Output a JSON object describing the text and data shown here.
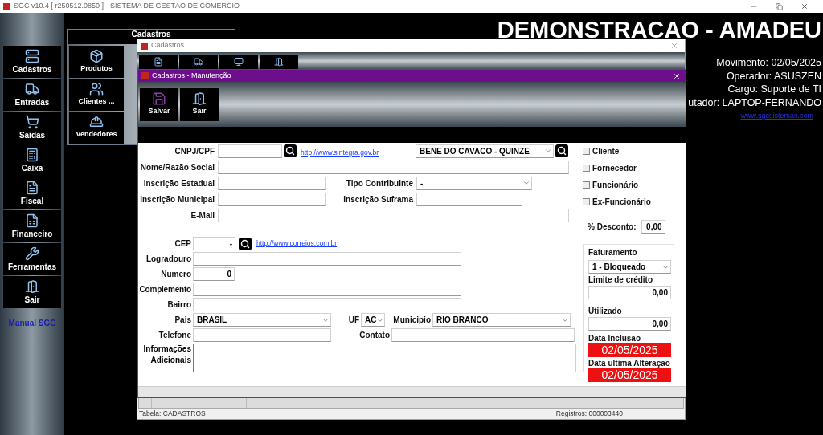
{
  "app": {
    "title": "SGC v10.4 [ r250512.0850 ] - SISTEMA DE GESTÃO DE COMÉRCIO"
  },
  "sidebar": {
    "items": [
      "Cadastros",
      "Entradas",
      "Saidas",
      "Caixa",
      "Fiscal",
      "Financeiro",
      "Ferramentas",
      "Sair"
    ],
    "manual_link": "Manual SGC"
  },
  "submenu": {
    "title": "Cadastros",
    "items": [
      "Produtos",
      "Clientes ...",
      "Vendedores"
    ]
  },
  "header": {
    "company": "DEMONSTRACAO - AMADEU",
    "info": [
      "Movimento: 02/05/2025",
      "Operador: ASUSZEN",
      "Cargo: Suporte de TI",
      "utador: LAPTOP-FERNANDO"
    ],
    "link": "www.sgcsistemas.com"
  },
  "cadastros_window": {
    "title": "Cadastros",
    "status_bar": {
      "table": "Tabela: CADASTROS",
      "records": "Registros: 000003440"
    }
  },
  "maintenance_window": {
    "title": "Cadastros - Manutenção",
    "toolbar": [
      "Salvar",
      "Sair"
    ],
    "form": {
      "cnpj": {
        "label": "CNPJ/CPF"
      },
      "sintegra_link": "http://www.sintegra.gov.br",
      "lookup": {
        "value": "BENE DO CAVACO - QUINZE"
      },
      "name": {
        "label": "Nome/Razão Social"
      },
      "state_registration": {
        "label": "Inscrição Estadual"
      },
      "taxpayer_type": {
        "label": "Tipo Contribuinte",
        "value": "-"
      },
      "municipal_registration": {
        "label": "Inscrição Municipal"
      },
      "suframa": {
        "label": "Inscrição Suframa"
      },
      "email": {
        "label": "E-Mail"
      },
      "cep": {
        "label": "CEP",
        "value": "-"
      },
      "correios_link": "http://www.correios.com.br",
      "street": {
        "label": "Logradouro"
      },
      "number": {
        "label": "Numero",
        "value": "0"
      },
      "complement": {
        "label": "Complemento"
      },
      "district": {
        "label": "Bairro"
      },
      "country": {
        "label": "Pais",
        "value": "BRASIL"
      },
      "uf": {
        "label": "UF",
        "value": "AC"
      },
      "city": {
        "label": "Municipio",
        "value": "RIO BRANCO"
      },
      "phone": {
        "label": "Telefone"
      },
      "contact": {
        "label": "Contato"
      },
      "notes": {
        "label": "Informações Adicionais"
      },
      "roles": [
        {
          "label": "Cliente",
          "checked": false
        },
        {
          "label": "Fornecedor",
          "checked": false
        },
        {
          "label": "Funcionário",
          "checked": false
        },
        {
          "label": "Ex-Funcionário",
          "checked": false
        }
      ],
      "discount": {
        "label": "% Desconto:",
        "value": "0,00"
      },
      "billing": {
        "title": "Faturamento",
        "status": "1 - Bloqueado",
        "credit_label": "Limite de crédito",
        "credit": "0,00",
        "used_label": "Utilizado",
        "used": "0,00",
        "created_label": "Data Inclusão",
        "created": "02/05/2025",
        "changed_label": "Data ultima Alteração",
        "changed": "02/05/2025"
      }
    }
  }
}
